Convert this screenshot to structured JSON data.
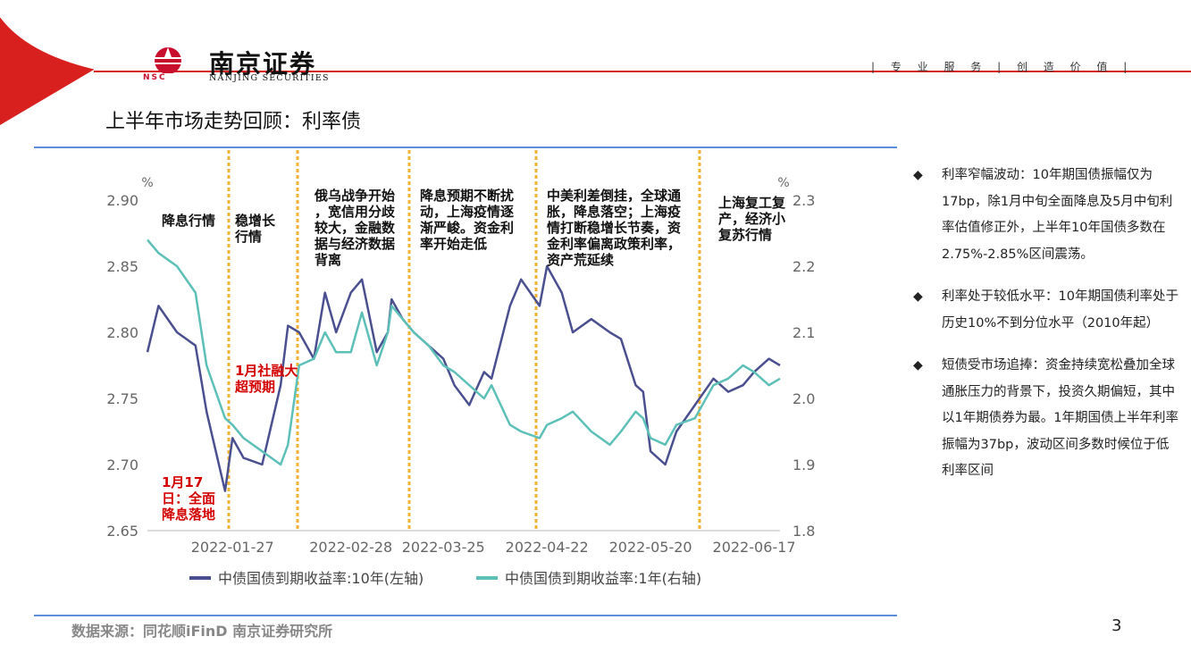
{
  "header": {
    "logo_name": "南京证券",
    "logo_sub": "NANJING SECURITIES",
    "logo_abbr": "NSC",
    "slogan": "| 专 业 服 务 | 创 造 价 值 |",
    "brand_color": "#c8102e"
  },
  "page_title": "上半年市场走势回顾：利率债",
  "chart_data": {
    "type": "line",
    "x": [
      "2022-01-04",
      "2022-01-07",
      "2022-01-12",
      "2022-01-17",
      "2022-01-20",
      "2022-01-25",
      "2022-01-27",
      "2022-01-30",
      "2022-02-04",
      "2022-02-09",
      "2022-02-11",
      "2022-02-14",
      "2022-02-18",
      "2022-02-21",
      "2022-02-24",
      "2022-02-28",
      "2022-03-03",
      "2022-03-07",
      "2022-03-10",
      "2022-03-11",
      "2022-03-14",
      "2022-03-17",
      "2022-03-21",
      "2022-03-25",
      "2022-03-28",
      "2022-04-01",
      "2022-04-05",
      "2022-04-07",
      "2022-04-12",
      "2022-04-15",
      "2022-04-20",
      "2022-04-22",
      "2022-04-26",
      "2022-04-29",
      "2022-05-04",
      "2022-05-09",
      "2022-05-12",
      "2022-05-16",
      "2022-05-18",
      "2022-05-20",
      "2022-05-24",
      "2022-05-27",
      "2022-06-01",
      "2022-06-06",
      "2022-06-10",
      "2022-06-14",
      "2022-06-17",
      "2022-06-21",
      "2022-06-24"
    ],
    "x_ticks": [
      "2022-01-27",
      "2022-02-28",
      "2022-03-25",
      "2022-04-22",
      "2022-05-20",
      "2022-06-17"
    ],
    "y_left_ticks": [
      "2.65",
      "2.70",
      "2.75",
      "2.80",
      "2.85",
      "2.90"
    ],
    "y_right_ticks": [
      "1.8",
      "1.9",
      "2.0",
      "2.1",
      "2.2",
      "2.3"
    ],
    "ylabel_left": "%",
    "ylabel_right": "%",
    "ylim_left": [
      2.65,
      2.9
    ],
    "ylim_right": [
      1.8,
      2.3
    ],
    "series": [
      {
        "name": "中债国债到期收益率:10年(左轴)",
        "axis": "left",
        "color": "#4a4f8f",
        "values": [
          2.785,
          2.82,
          2.8,
          2.79,
          2.74,
          2.68,
          2.72,
          2.705,
          2.7,
          2.76,
          2.805,
          2.8,
          2.78,
          2.83,
          2.8,
          2.83,
          2.84,
          2.785,
          2.8,
          2.825,
          2.81,
          2.8,
          2.79,
          2.78,
          2.76,
          2.745,
          2.77,
          2.765,
          2.82,
          2.84,
          2.82,
          2.85,
          2.83,
          2.8,
          2.81,
          2.8,
          2.795,
          2.76,
          2.755,
          2.71,
          2.7,
          2.725,
          2.745,
          2.765,
          2.755,
          2.76,
          2.77,
          2.78,
          2.775
        ]
      },
      {
        "name": "中债国债到期收益率:1年(右轴)",
        "axis": "right",
        "color": "#5dc0b8",
        "values": [
          2.24,
          2.22,
          2.2,
          2.16,
          2.05,
          1.97,
          1.96,
          1.94,
          1.92,
          1.9,
          1.93,
          2.05,
          2.06,
          2.1,
          2.07,
          2.07,
          2.13,
          2.05,
          2.1,
          2.14,
          2.12,
          2.1,
          2.08,
          2.05,
          2.04,
          2.02,
          2.0,
          2.02,
          1.96,
          1.95,
          1.94,
          1.96,
          1.97,
          1.98,
          1.95,
          1.93,
          1.95,
          1.98,
          1.97,
          1.94,
          1.93,
          1.96,
          1.97,
          2.02,
          2.03,
          2.05,
          2.04,
          2.02,
          2.03
        ]
      }
    ],
    "annotations": [
      {
        "text": "降息行情",
        "color": "#111111"
      },
      {
        "text": "稳增长行情",
        "color": "#111111"
      },
      {
        "text": "俄乌战争开始，宽信用分歧较大，金融数据与经济数据背离",
        "color": "#111111"
      },
      {
        "text": "降息预期不断扰动，上海疫情逐渐严峻。资金利率开始走低",
        "color": "#111111"
      },
      {
        "text": "中美利差倒挂，全球通胀，降息落空；上海疫情打断稳增长节奏，资金利率偏离政策利率，资产荒延续",
        "color": "#111111"
      },
      {
        "text": "上海复工复产，经济小复苏行情",
        "color": "#111111"
      },
      {
        "text": "1月社融大超预期",
        "color": "#d40000"
      },
      {
        "text": "1月17日：全面降息落地",
        "color": "#d40000"
      }
    ],
    "grid": false,
    "legend": "bottom"
  },
  "bullets": [
    {
      "text": "利率窄幅波动：10年期国债振幅仅为17bp，除1月中旬全面降息及5月中旬利率估值修正外，上半年10年国债多数在2.75%-2.85%区间震荡。"
    },
    {
      "text": "利率处于较低水平：10年期国债利率处于历史10%不到分位水平（2010年起）"
    },
    {
      "text": "短债受市场追捧：资金持续宽松叠加全球通胀压力的背景下，投资久期偏短，其中以1年期债券为最。1年期国债上半年利率振幅为37bp，波动区间多数时候位于低利率区间"
    }
  ],
  "footer": {
    "source": "数据来源：同花顺iFinD 南京证券研究所",
    "page_number": "3"
  }
}
